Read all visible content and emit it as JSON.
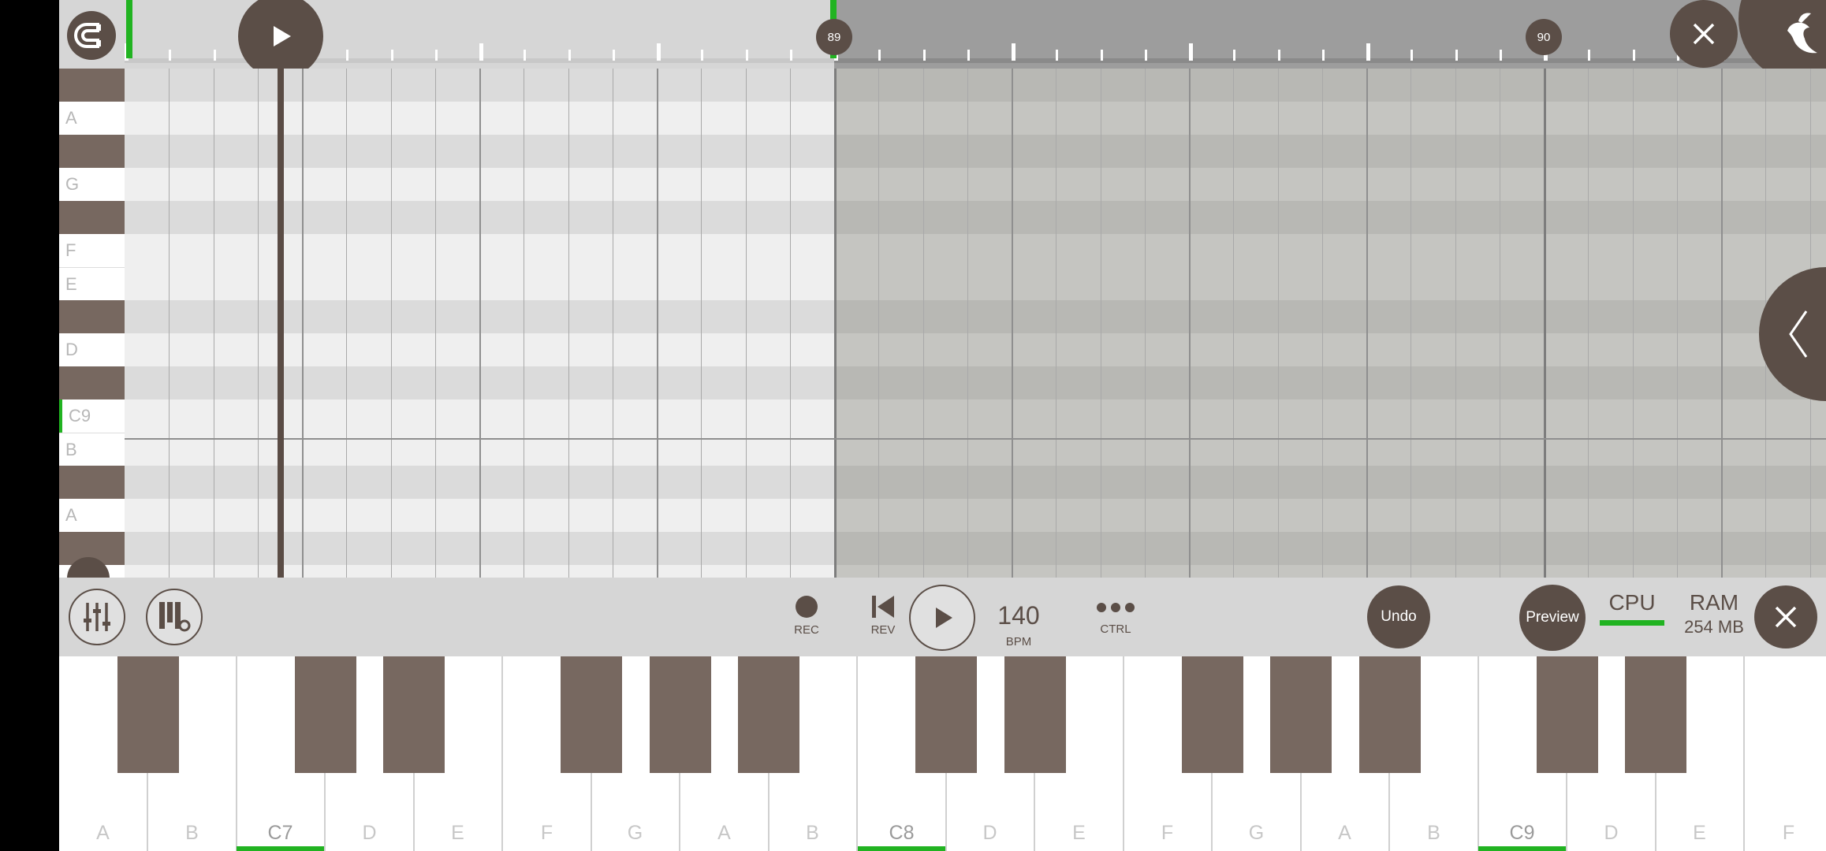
{
  "timeline": {
    "badge_left": "89",
    "badge_right": "90",
    "play_icon": "play-icon",
    "magnet_icon": "magnet-icon",
    "close_icon": "close-icon",
    "logo_icon": "fruit-logo-icon"
  },
  "key_labels": [
    "",
    "A",
    "",
    "G",
    "",
    "F",
    "E",
    "",
    "D",
    "",
    "C9",
    "B",
    "",
    "A",
    ""
  ],
  "transport": {
    "rec_label": "REC",
    "rev_label": "REV",
    "bpm_value": "140",
    "bpm_label": "BPM",
    "ctrl_label": "CTRL",
    "undo_label": "Undo",
    "preview_label": "Preview",
    "cpu_label": "CPU",
    "ram_label": "RAM",
    "ram_value": "254 MB",
    "cpu_level": 1.0,
    "accent": "#21b321",
    "dark": "#5b4e47"
  },
  "keyboard": {
    "white_keys": [
      "A",
      "B",
      "C7",
      "D",
      "E",
      "F",
      "G",
      "A",
      "B",
      "C8",
      "D",
      "E",
      "F",
      "G",
      "A",
      "B",
      "C9",
      "D",
      "E",
      "F"
    ]
  }
}
